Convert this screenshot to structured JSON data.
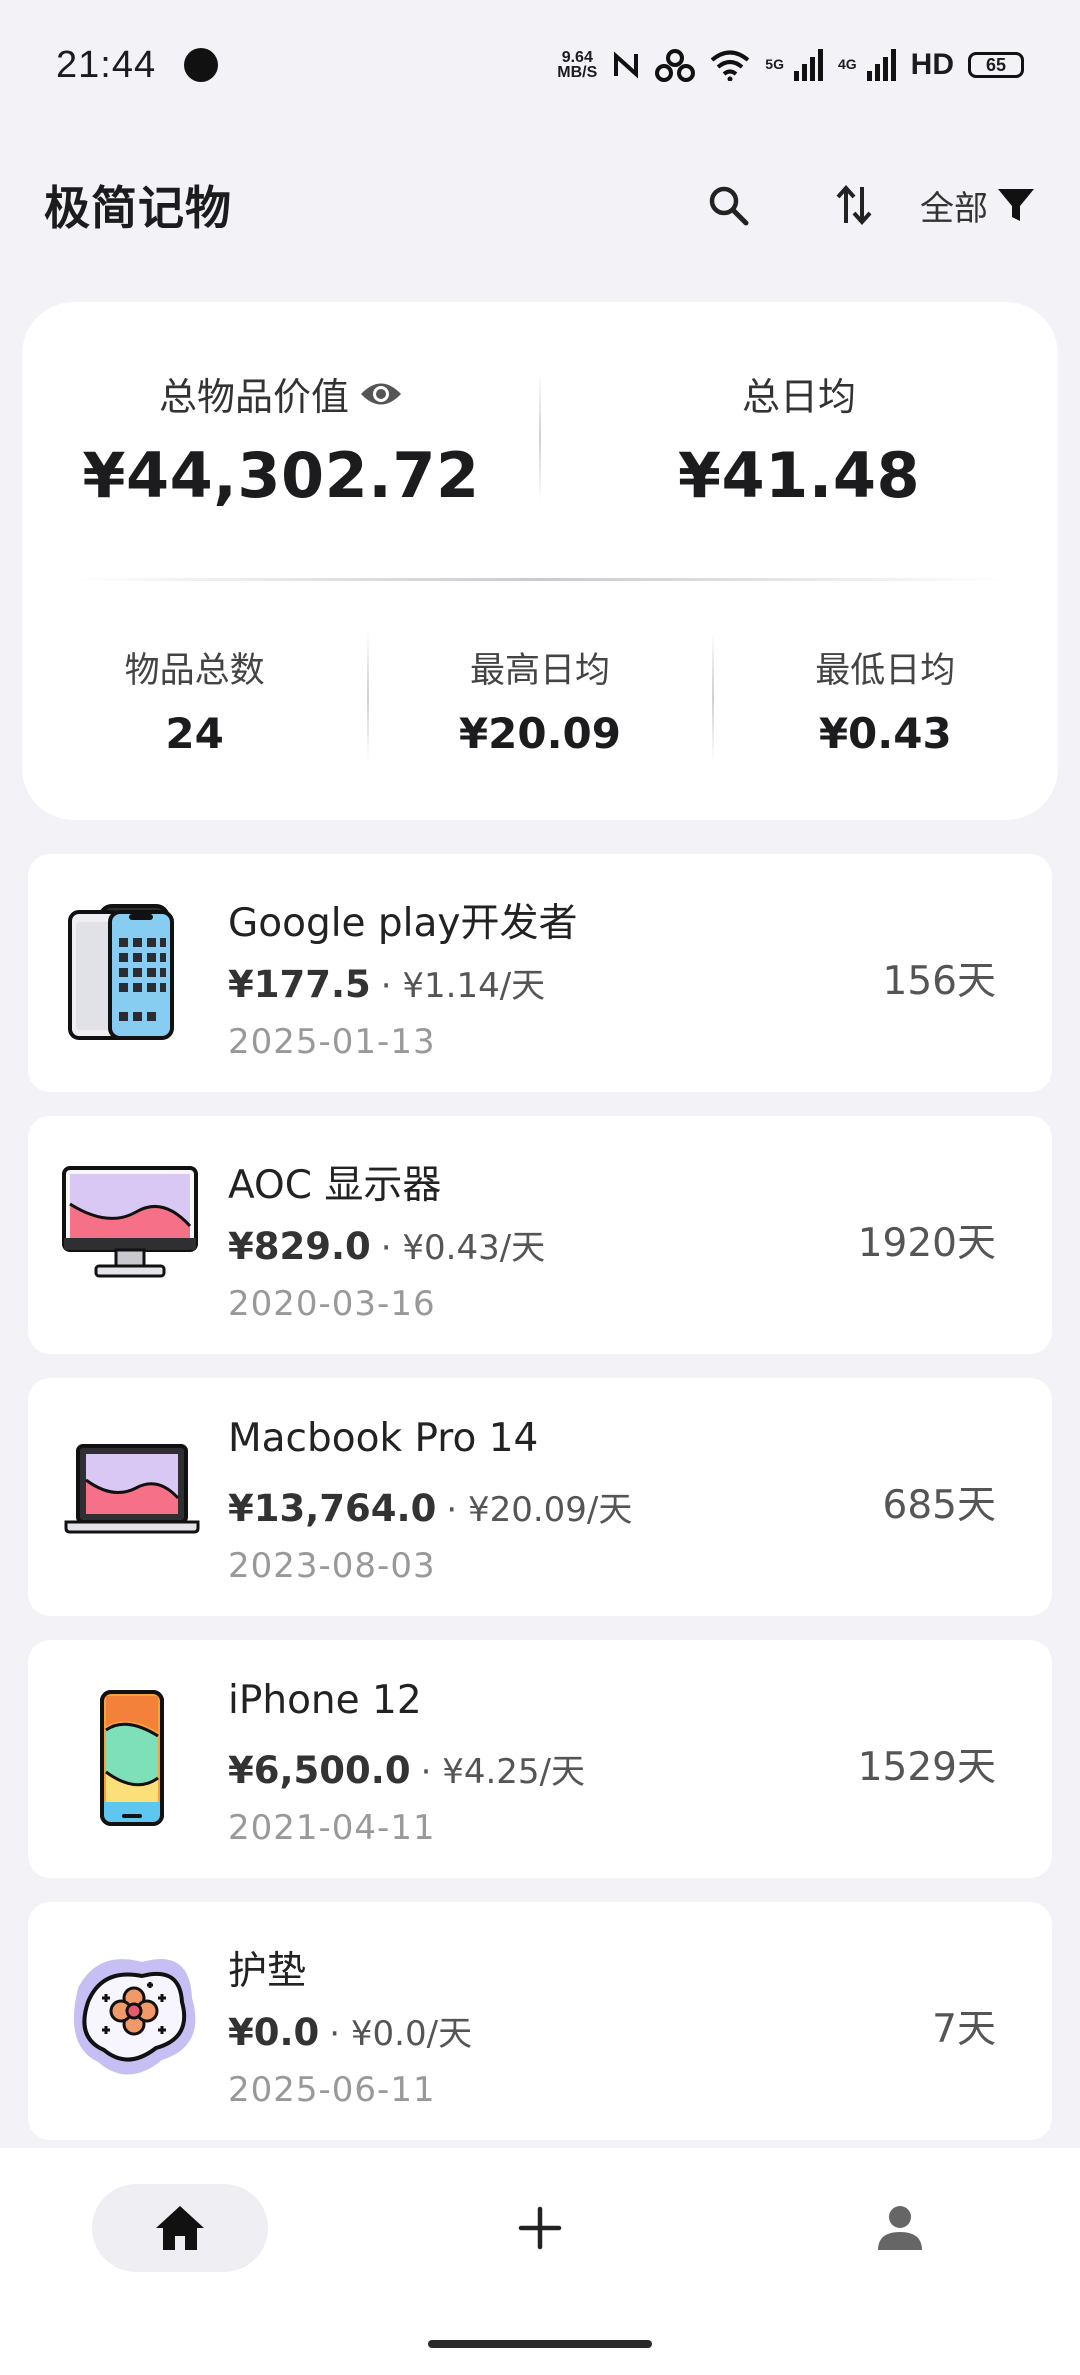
{
  "status_bar": {
    "time": "21:44",
    "net_speed_value": "9.64",
    "net_speed_unit": "MB/S",
    "signal1_label": "5G",
    "signal2_label": "4G",
    "hd_label": "HD",
    "battery": "65"
  },
  "header": {
    "title": "极简记物",
    "filter_label": "全部"
  },
  "summary": {
    "total_value_label": "总物品价值",
    "total_value": "¥44,302.72",
    "daily_avg_label": "总日均",
    "daily_avg": "¥41.48",
    "count_label": "物品总数",
    "count": "24",
    "max_daily_label": "最高日均",
    "max_daily": "¥20.09",
    "min_daily_label": "最低日均",
    "min_daily": "¥0.43"
  },
  "items": [
    {
      "name": "Google play开发者",
      "price": "¥177.5",
      "daily": "· ¥1.14/天",
      "date": "2025-01-13",
      "days": "156天",
      "icon": "phone-icon"
    },
    {
      "name": "AOC 显示器",
      "price": "¥829.0",
      "daily": "· ¥0.43/天",
      "date": "2020-03-16",
      "days": "1920天",
      "icon": "monitor-icon"
    },
    {
      "name": "Macbook Pro 14",
      "price": "¥13,764.0",
      "daily": "· ¥20.09/天",
      "date": "2023-08-03",
      "days": "685天",
      "icon": "laptop-icon"
    },
    {
      "name": "iPhone 12",
      "price": "¥6,500.0",
      "daily": "· ¥4.25/天",
      "date": "2021-04-11",
      "days": "1529天",
      "icon": "smartphone-icon"
    },
    {
      "name": "护垫",
      "price": "¥0.0",
      "daily": "· ¥0.0/天",
      "date": "2025-06-11",
      "days": "7天",
      "icon": "pad-icon"
    }
  ],
  "nav": {
    "home_icon": "home-icon",
    "add_icon": "plus-icon",
    "profile_icon": "person-icon"
  }
}
